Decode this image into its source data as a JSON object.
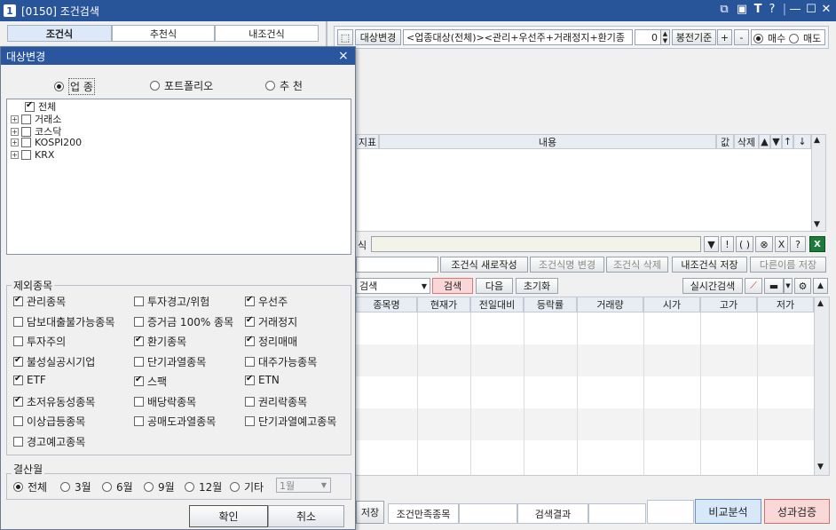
{
  "window": {
    "number": "1",
    "title": "[0150] 조건검색",
    "controls": [
      "⧉",
      "▣",
      "T",
      "?",
      "|",
      "—",
      "☐",
      "✕"
    ]
  },
  "tabs": [
    {
      "label": "조건식",
      "active": true
    },
    {
      "label": "추천식",
      "active": false
    },
    {
      "label": "내조건식",
      "active": false
    }
  ],
  "toolbar": {
    "target_change": "대상변경",
    "target_text": "<업종대상(전체)><관리+우선주+거래정지+환기종",
    "spin_value": "0",
    "bar_basis": "봉전기준",
    "plus": "+",
    "minus": "-",
    "buy": "매수",
    "sell": "매도"
  },
  "condition_grid": {
    "headers": [
      "지표",
      "내용",
      "값",
      "삭제",
      "▲",
      "▼",
      "↑",
      "↓"
    ]
  },
  "formula": {
    "label": "식",
    "value": "",
    "ops": [
      "▼",
      "!",
      "( )",
      "⊗",
      "X",
      "?"
    ]
  },
  "cond_buttons": {
    "name_value": "",
    "new": "조건식 새로작성",
    "rename": "조건식명 변경",
    "delete": "조건식 삭제",
    "save": "내조건식 저장",
    "save_as": "다른이름 저장"
  },
  "search_bar": {
    "select": "검색",
    "search": "검색",
    "next": "다음",
    "reset": "초기화",
    "realtime": "실시간검색"
  },
  "result_grid": {
    "headers": [
      "종목명",
      "현재가",
      "전일대비",
      "등락률",
      "거래량",
      "시가",
      "고가",
      "저가"
    ]
  },
  "status_bar": {
    "save_tail": "저장",
    "match_label": "조건만족종목",
    "match_value": "",
    "result_label": "검색결과",
    "result_value": "",
    "extra": "",
    "compare": "비교분석",
    "verify": "성과검증"
  },
  "dialog": {
    "title": "대상변경",
    "close": "×",
    "modes": [
      {
        "label": "업 종",
        "on": true
      },
      {
        "label": "포트폴리오",
        "on": false
      },
      {
        "label": "추 천",
        "on": false
      }
    ],
    "tree": [
      {
        "label": "전체",
        "checked": true,
        "expander": false
      },
      {
        "label": "거래소",
        "checked": false,
        "expander": true
      },
      {
        "label": "코스닥",
        "checked": false,
        "expander": true
      },
      {
        "label": "KOSPI200",
        "checked": false,
        "expander": true
      },
      {
        "label": "KRX",
        "checked": false,
        "expander": true
      }
    ],
    "exclude_label": "제외종목",
    "exclude": [
      {
        "label": "관리종목",
        "checked": true
      },
      {
        "label": "투자경고/위험",
        "checked": false
      },
      {
        "label": "우선주",
        "checked": true
      },
      {
        "label": "담보대출불가능종목",
        "checked": false
      },
      {
        "label": "증거금 100% 종목",
        "checked": false
      },
      {
        "label": "거래정지",
        "checked": true
      },
      {
        "label": "투자주의",
        "checked": false
      },
      {
        "label": "환기종목",
        "checked": true
      },
      {
        "label": "정리매매",
        "checked": true
      },
      {
        "label": "불성실공시기업",
        "checked": true
      },
      {
        "label": "단기과열종목",
        "checked": false
      },
      {
        "label": "대주가능종목",
        "checked": false
      },
      {
        "label": "ETF",
        "checked": true
      },
      {
        "label": "스팩",
        "checked": true
      },
      {
        "label": "ETN",
        "checked": true
      },
      {
        "label": "초저유동성종목",
        "checked": true
      },
      {
        "label": "배당락종목",
        "checked": false
      },
      {
        "label": "권리락종목",
        "checked": false
      },
      {
        "label": "이상급등종목",
        "checked": false
      },
      {
        "label": "공매도과열종목",
        "checked": false
      },
      {
        "label": "단기과열예고종목",
        "checked": false
      },
      {
        "label": "경고예고종목",
        "checked": false
      }
    ],
    "settle_label": "결산월",
    "settle": [
      {
        "label": "전체",
        "on": true
      },
      {
        "label": "3월",
        "on": false
      },
      {
        "label": "6월",
        "on": false
      },
      {
        "label": "9월",
        "on": false
      },
      {
        "label": "12월",
        "on": false
      },
      {
        "label": "기타",
        "on": false
      }
    ],
    "month_select": "1월",
    "ok": "확인",
    "cancel": "취소"
  }
}
